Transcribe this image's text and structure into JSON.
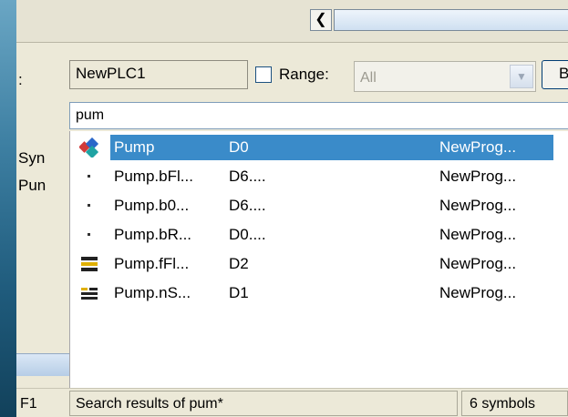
{
  "filter": {
    "plc_value": "NewPLC1",
    "range_label": "Range:",
    "range_value": "All",
    "button_label": "B",
    "search_value": "pum"
  },
  "side_labels": [
    "Syn",
    "Pun"
  ],
  "results": [
    {
      "name": "Pump",
      "address": "D0",
      "scope": "NewProg...",
      "icon": "program-blocks-icon",
      "selected": true
    },
    {
      "name": "Pump.bFl...",
      "address": "D6....",
      "scope": "NewProg...",
      "icon": "bit-dot-icon",
      "selected": false
    },
    {
      "name": "Pump.b0...",
      "address": "D6....",
      "scope": "NewProg...",
      "icon": "bit-dot-icon",
      "selected": false
    },
    {
      "name": "Pump.bR...",
      "address": "D0....",
      "scope": "NewProg...",
      "icon": "bit-dot-icon",
      "selected": false
    },
    {
      "name": "Pump.fFl...",
      "address": "D2",
      "scope": "NewProg...",
      "icon": "float-stack-icon",
      "selected": false
    },
    {
      "name": "Pump.nS...",
      "address": "D1",
      "scope": "NewProg...",
      "icon": "integer-icon",
      "selected": false
    }
  ],
  "status": {
    "key_hint": "F1",
    "message": "Search results of pum*",
    "count": "6 symbols"
  },
  "colors": {
    "selection": "#3a8bc9",
    "panel_bg": "#ece9d8"
  }
}
